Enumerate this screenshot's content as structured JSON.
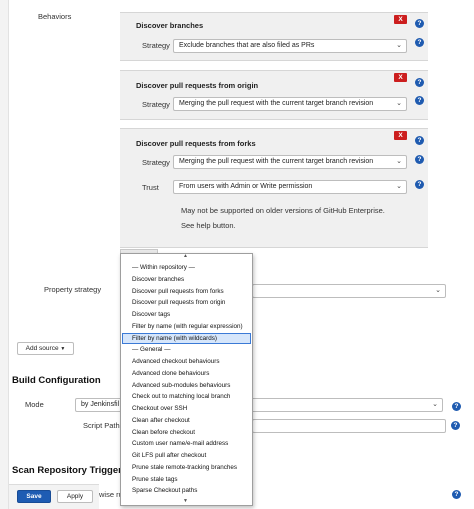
{
  "behaviors": {
    "label": "Behaviors",
    "discover_branches": {
      "title": "Discover branches",
      "strategy_label": "Strategy",
      "strategy_value": "Exclude branches that are also filed as PRs"
    },
    "discover_prs_origin": {
      "title": "Discover pull requests from origin",
      "strategy_label": "Strategy",
      "strategy_value": "Merging the pull request with the current target branch revision"
    },
    "discover_prs_forks": {
      "title": "Discover pull requests from forks",
      "strategy_label": "Strategy",
      "strategy_value": "Merging the pull request with the current target branch revision",
      "trust_label": "Trust",
      "trust_value": "From users with Admin or Write permission",
      "note_line1": "May not be supported on older versions of GitHub Enterprise.",
      "note_line2": "See help button."
    },
    "delete_label": "X",
    "help_label": "?"
  },
  "property_strategy": {
    "label": "Property strategy"
  },
  "add_source": {
    "label": "Add source"
  },
  "build_config": {
    "heading": "Build Configuration",
    "mode_label": "Mode",
    "mode_value": "by Jenkinsfil",
    "script_path_label": "Script Path"
  },
  "scan_triggers": {
    "heading": "Scan Repository Triggers",
    "partial_text": "wise ru"
  },
  "footer": {
    "save": "Save",
    "apply": "Apply"
  },
  "dropdown": {
    "items": [
      "— Within repository —",
      "Discover branches",
      "Discover pull requests from forks",
      "Discover pull requests from origin",
      "Discover tags",
      "Filter by name (with regular expression)",
      "Filter by name (with wildcards)",
      "— General —",
      "Advanced checkout behaviours",
      "Advanced clone behaviours",
      "Advanced sub-modules behaviours",
      "Check out to matching local branch",
      "Checkout over SSH",
      "Clean after checkout",
      "Clean before checkout",
      "Custom user name/e-mail address",
      "Git LFS pull after checkout",
      "Prune stale remote-tracking branches",
      "Prune stale tags",
      "Sparse Checkout paths"
    ],
    "selected_index": 6
  },
  "icons": {
    "select_chevron": "chevron-down-icon",
    "help": "help-icon",
    "delete": "delete-icon"
  },
  "colors": {
    "accent": "#1e5cb3",
    "delete": "#cc1e1e",
    "panel_bg": "#f0f0f0",
    "selected_bg": "#d6e6fb"
  }
}
